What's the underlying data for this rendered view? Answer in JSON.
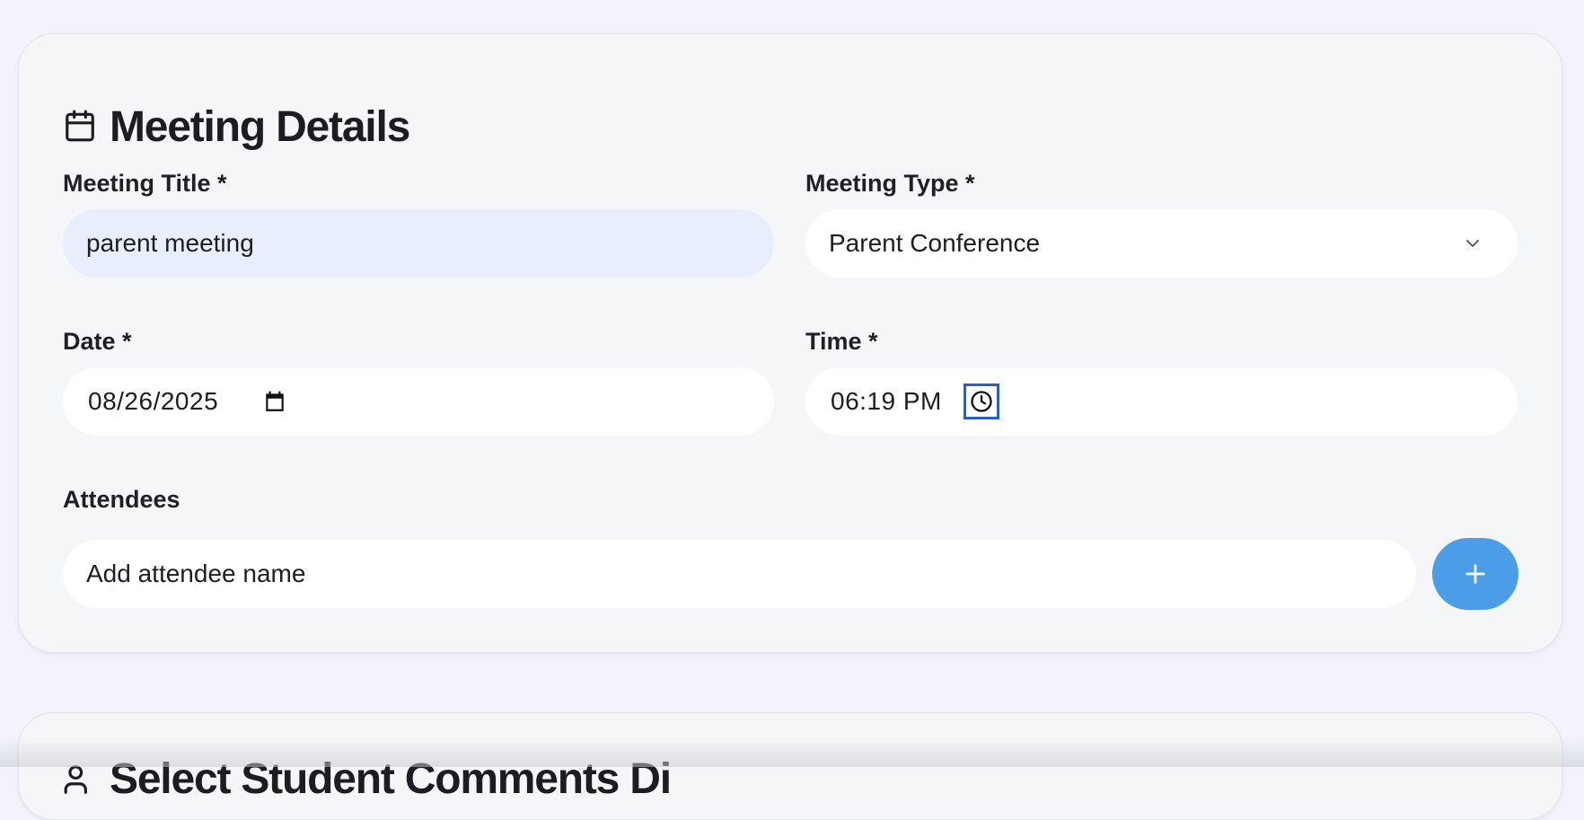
{
  "meeting_details": {
    "title": "Meeting Details",
    "icon": "calendar-icon",
    "meeting_title": {
      "label": "Meeting Title *",
      "value": "parent meeting"
    },
    "meeting_type": {
      "label": "Meeting Type *",
      "value": "Parent Conference"
    },
    "date": {
      "label": "Date *",
      "value": "08/26/2025"
    },
    "time": {
      "label": "Time *",
      "value": "06:19 PM"
    },
    "attendees": {
      "label": "Attendees",
      "placeholder": "Add attendee name",
      "add_icon": "plus-icon"
    }
  },
  "next_section": {
    "title": "Select Student Comments Di",
    "icon": "users-icon"
  },
  "colors": {
    "accent": "#4a9de6",
    "focus_ring": "#2a5fc4",
    "filled_input": "#e8eefb"
  }
}
